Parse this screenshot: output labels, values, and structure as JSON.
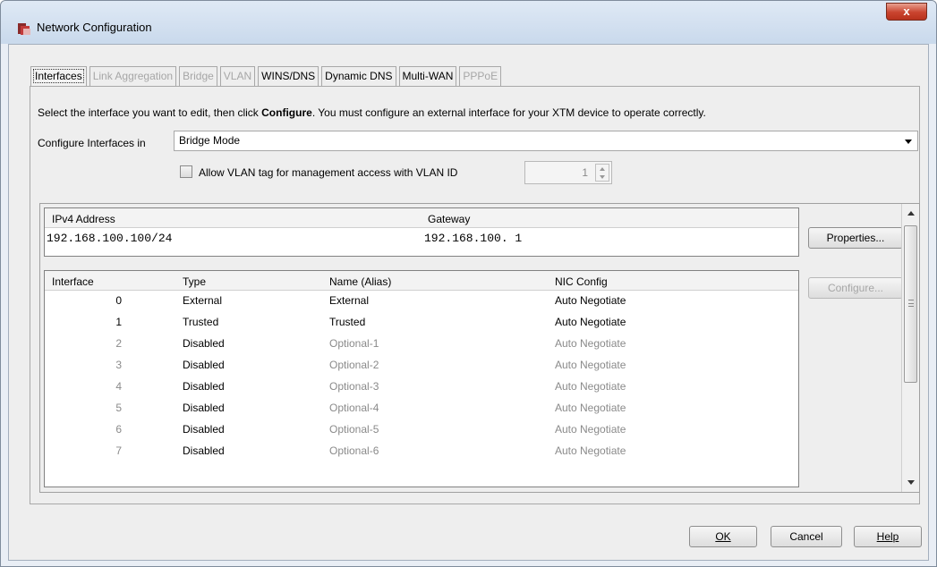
{
  "window": {
    "title": "Network Configuration",
    "close_label": "x"
  },
  "tabs": [
    {
      "label": "Interfaces",
      "state": "active"
    },
    {
      "label": "Link Aggregation",
      "state": "disabled"
    },
    {
      "label": "Bridge",
      "state": "disabled"
    },
    {
      "label": "VLAN",
      "state": "disabled"
    },
    {
      "label": "WINS/DNS",
      "state": "enabled"
    },
    {
      "label": "Dynamic DNS",
      "state": "enabled"
    },
    {
      "label": "Multi-WAN",
      "state": "enabled"
    },
    {
      "label": "PPPoE",
      "state": "disabled"
    }
  ],
  "instruction": {
    "before": "Select the interface you want to edit, then click ",
    "bold": "Configure",
    "after": ". You must configure an external interface for your XTM device to operate correctly."
  },
  "configure_mode": {
    "label": "Configure Interfaces in",
    "value": "Bridge Mode"
  },
  "vlan": {
    "label": "Allow VLAN tag for management access with VLAN ID",
    "checked": false,
    "value": "1"
  },
  "ipv4_table": {
    "headers": [
      "IPv4 Address",
      "Gateway"
    ],
    "row": {
      "address": "192.168.100.100/24",
      "gateway": "192.168.100. 1"
    }
  },
  "properties_button": "Properties...",
  "configure_button": "Configure...",
  "interfaces_table": {
    "headers": [
      "Interface",
      "Type",
      "Name (Alias)",
      "NIC Config"
    ],
    "rows": [
      {
        "num": "0",
        "type": "External",
        "name": "External",
        "nic": "Auto Negotiate",
        "enabled": true
      },
      {
        "num": "1",
        "type": "Trusted",
        "name": "Trusted",
        "nic": "Auto Negotiate",
        "enabled": true
      },
      {
        "num": "2",
        "type": "Disabled",
        "name": "Optional-1",
        "nic": "Auto Negotiate",
        "enabled": false
      },
      {
        "num": "3",
        "type": "Disabled",
        "name": "Optional-2",
        "nic": "Auto Negotiate",
        "enabled": false
      },
      {
        "num": "4",
        "type": "Disabled",
        "name": "Optional-3",
        "nic": "Auto Negotiate",
        "enabled": false
      },
      {
        "num": "5",
        "type": "Disabled",
        "name": "Optional-4",
        "nic": "Auto Negotiate",
        "enabled": false
      },
      {
        "num": "6",
        "type": "Disabled",
        "name": "Optional-5",
        "nic": "Auto Negotiate",
        "enabled": false
      },
      {
        "num": "7",
        "type": "Disabled",
        "name": "Optional-6",
        "nic": "Auto Negotiate",
        "enabled": false
      }
    ]
  },
  "footer": {
    "ok": "OK",
    "cancel": "Cancel",
    "help": "Help"
  },
  "icons": {
    "app": "firebox-icon",
    "close": "close-icon"
  }
}
